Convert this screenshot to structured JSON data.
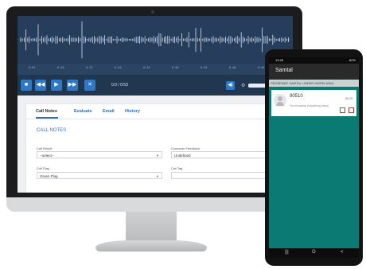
{
  "player": {
    "timeline_ticks": [
      "0:01",
      "0:10",
      "0:13",
      "0:20",
      "0:25",
      "0:30",
      "0:35",
      "0:40",
      "0:45"
    ],
    "time_readout": "0:0 / 0:53",
    "volume_level": 0.7,
    "buttons": {
      "stop": "■",
      "rewind": "◀◀",
      "play": "▶",
      "forward": "▶▶",
      "close": "✕"
    }
  },
  "tabs": [
    "Call Notes",
    "Evaluate",
    "Email",
    "History"
  ],
  "call_notes": {
    "section_title": "CALL NOTES",
    "call_result": {
      "label": "Call Result",
      "value": "--select--"
    },
    "customer_feedback": {
      "label": "Customer Feedback",
      "value": "Undefined"
    },
    "call_flag": {
      "label": "Call Flag",
      "value": "Green Flag"
    },
    "call_tag": {
      "label": "Call Tag",
      "value": ""
    }
  },
  "phone": {
    "status_time": "13:45",
    "status_right": "82%",
    "app_title": "Samtal",
    "banner": "PÅGÅENDE SAMTAL UNDER INSPELNING",
    "call": {
      "number": "90510",
      "subtitle": "Tar ett samtal (inspelning visas)",
      "duration": "00:01"
    },
    "nav": {
      "back": "|||",
      "home": "O",
      "recent": "<"
    }
  },
  "colors": {
    "wave_bg": "#263d5c",
    "accent_blue": "#2e78c7",
    "teal": "#0b7a73"
  }
}
